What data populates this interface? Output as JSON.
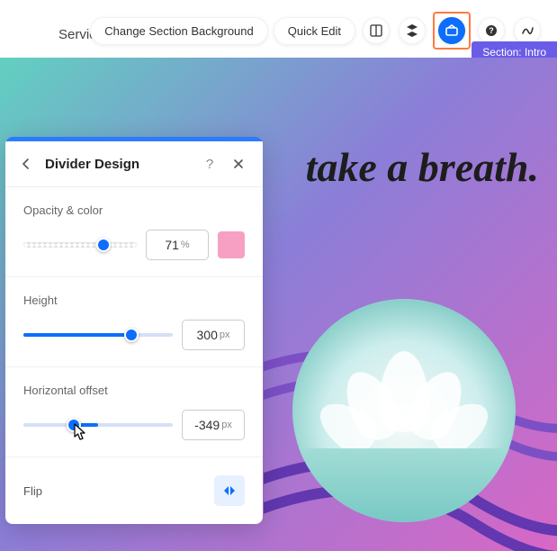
{
  "nav": {
    "services": "Services"
  },
  "toolbar": {
    "change_bg": "Change Section Background",
    "quick_edit": "Quick Edit"
  },
  "section_chip": "Section: Intro",
  "headline": "take a breath.",
  "panel": {
    "title": "Divider Design",
    "opacity": {
      "label": "Opacity & color",
      "value": "71",
      "unit": "%",
      "percent": 71,
      "swatch": "#f7a0c4"
    },
    "height": {
      "label": "Height",
      "value": "300",
      "unit": "px",
      "percent": 72
    },
    "hoffset": {
      "label": "Horizontal offset",
      "value": "-349",
      "unit": "px",
      "fill_start": 34,
      "fill_end": 50,
      "knob": 34
    },
    "flip": {
      "label": "Flip"
    }
  }
}
